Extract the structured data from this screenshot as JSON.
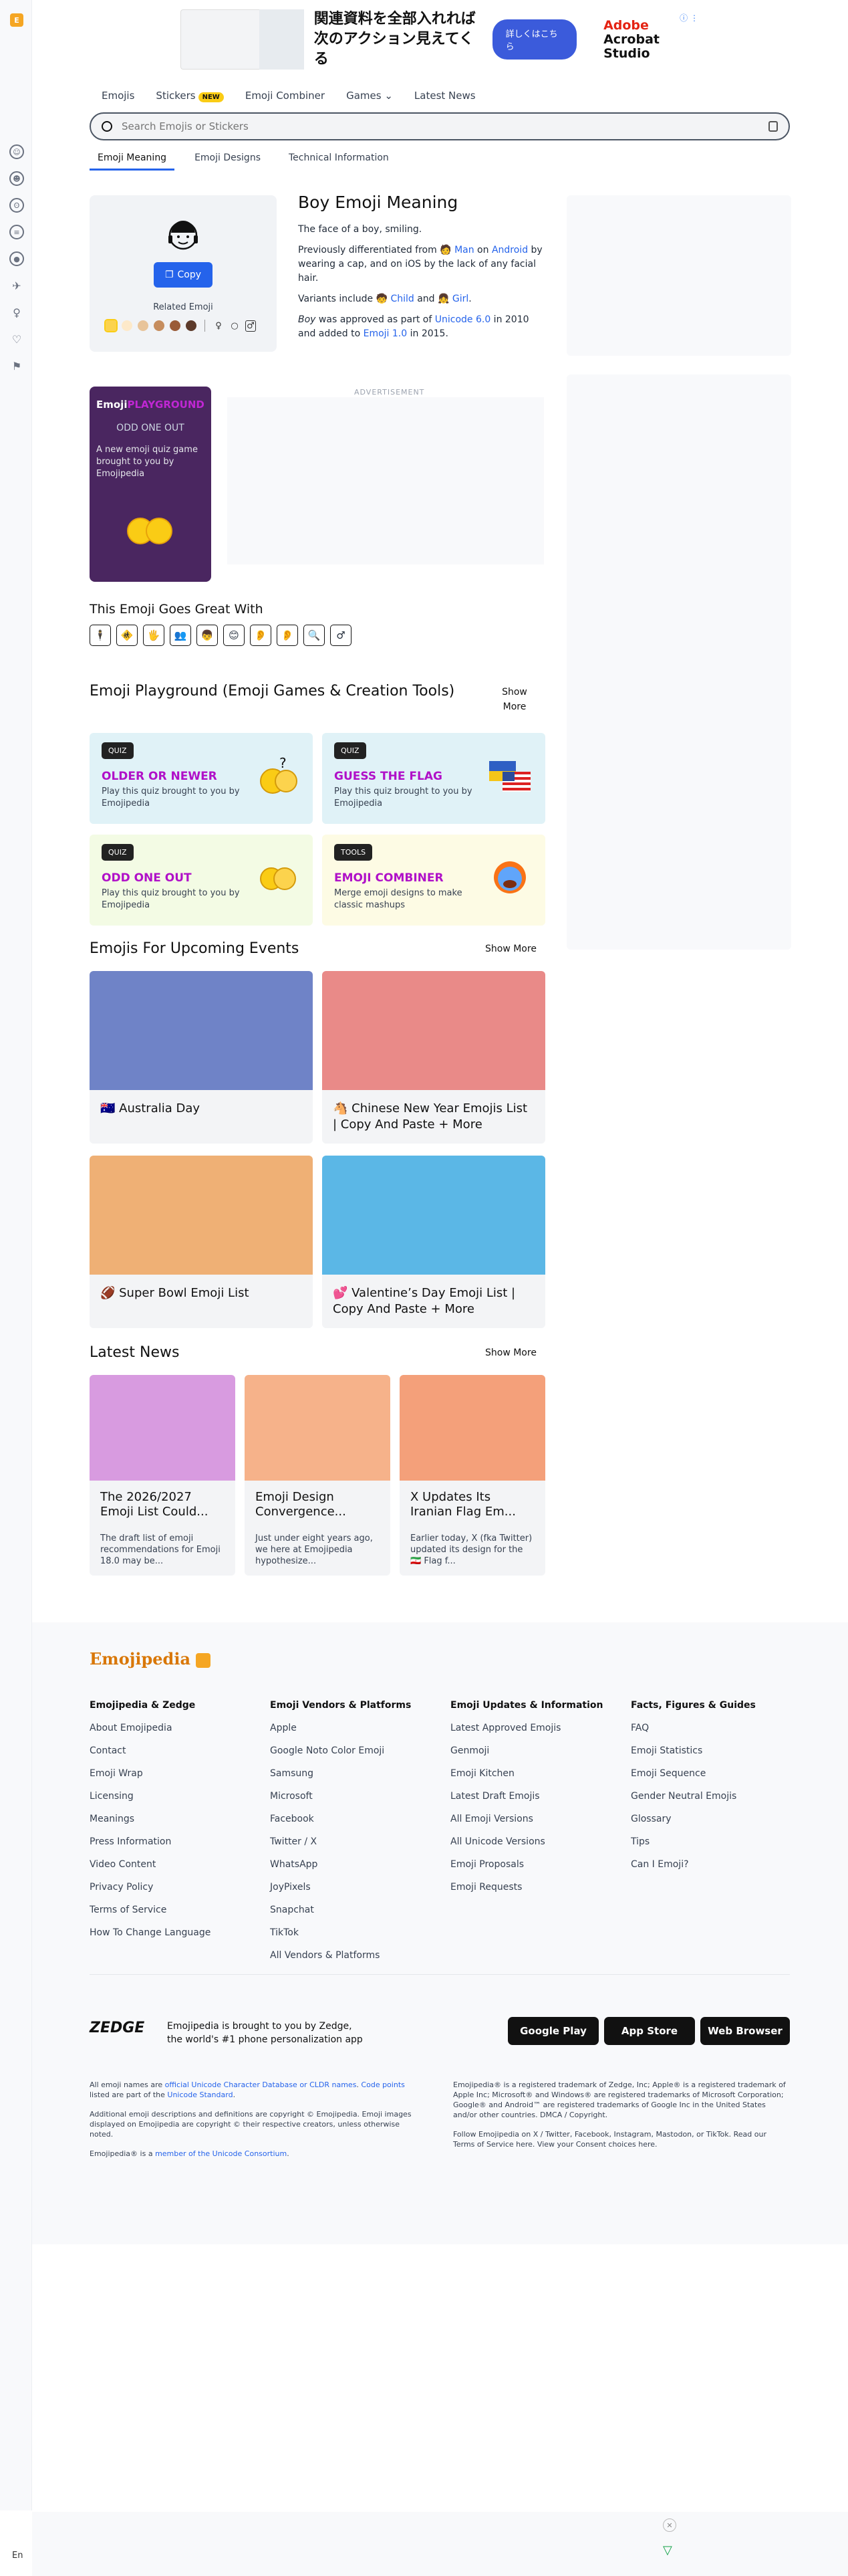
{
  "sidebar": {
    "logo": "E",
    "icons": [
      "smiley-icon",
      "person-icon",
      "bear-icon",
      "burger-icon",
      "ball-icon",
      "rocket-icon",
      "bulb-icon",
      "heart-icon",
      "flag-icon"
    ]
  },
  "ad_top": {
    "headline": "関連資料を全部入れれば\n次のアクション見えてくる",
    "button": "詳しくはこちら",
    "brand_line1": "Adobe",
    "brand_line2": "Acrobat Studio",
    "info": "ⓘ ⋮"
  },
  "nav": {
    "emojis": "Emojis",
    "stickers": "Stickers",
    "new_badge": "NEW",
    "combiner": "Emoji Combiner",
    "games": "Games",
    "games_caret": "⌄",
    "news": "Latest News"
  },
  "search": {
    "placeholder": "Search Emojis or Stickers"
  },
  "tabs": [
    "Emoji Meaning",
    "Emoji Designs",
    "Technical Information"
  ],
  "emoji": {
    "copy": "Copy",
    "related": "Related Emoji",
    "swatch_colors": [
      "#fcd34d",
      "#fde9c9",
      "#e8c49a",
      "#c68d5e",
      "#9a5b38",
      "#5c3a2a"
    ],
    "title": "Boy Emoji Meaning",
    "p1": "The face of a boy, smiling.",
    "p2_pre": "Previously differentiated from ",
    "p2_man": "🧑 Man",
    "p2_on": " on ",
    "p2_android": "Android",
    "p2_post": " by wearing a cap, and on iOS by the lack of any facial hair.",
    "p3_pre": "Variants include ",
    "p3_child": "🧒 Child",
    "p3_and": " and ",
    "p3_girl": "👧 Girl",
    "p3_post": ".",
    "p4_boy": "Boy",
    "p4_a": " was approved as part of ",
    "p4_u6": "Unicode 6.0",
    "p4_b": " in 2010 and added to ",
    "p4_e1": "Emoji 1.0",
    "p4_c": " in 2015."
  },
  "playground_ad": {
    "title_a": "Emoji",
    "title_b": "PLAYGROUND",
    "sub": "ODD ONE OUT",
    "desc": "A new emoji quiz game brought to you by Emojipedia"
  },
  "advertisement": "ADVERTISEMENT",
  "goes_great": {
    "title": "This Emoji Goes Great With",
    "items": [
      "🕴",
      "🚸",
      "🖐",
      "👥",
      "👦",
      "😊",
      "👂",
      "👂",
      "🔍",
      "♂"
    ]
  },
  "playground": {
    "title": "Emoji Playground (Emoji Games & Creation Tools)",
    "show_more": "Show More",
    "cards": [
      {
        "tag": "QUIZ",
        "name": "OLDER OR NEWER",
        "desc": "Play this quiz brought to you by Emojipedia",
        "bg": "#e0f2f7"
      },
      {
        "tag": "QUIZ",
        "name": "GUESS THE FLAG",
        "desc": "Play this quiz brought to you by Emojipedia",
        "bg": "#e0f2f7"
      },
      {
        "tag": "QUIZ",
        "name": "ODD ONE OUT",
        "desc": "Play this quiz brought to you by Emojipedia",
        "bg": "#f3fbe4"
      },
      {
        "tag": "TOOLS",
        "name": "EMOJI COMBINER",
        "desc": "Merge emoji designs to make classic mashups",
        "bg": "#fdfbe4"
      }
    ]
  },
  "events": {
    "title": "Emojis For Upcoming Events",
    "show_more": "Show More",
    "cards": [
      {
        "title": "🇦🇺 Australia Day",
        "bg": "#6f83c7"
      },
      {
        "title": "🐴 Chinese New Year Emojis List | Copy And Paste + More",
        "bg": "#e98a88"
      },
      {
        "title": "🏈 Super Bowl Emoji List",
        "bg": "#efb075"
      },
      {
        "title": "💕 Valentine’s Day Emoji List | Copy And Paste + More",
        "bg": "#5bb7e6"
      }
    ]
  },
  "news": {
    "title": "Latest News",
    "show_more": "Show More",
    "cards": [
      {
        "title": "The 2026/2027 Emoji List Could...",
        "desc": "The draft list of emoji recommendations for Emoji 18.0 may be...",
        "bg": "#d89be0"
      },
      {
        "title": "Emoji Design Convergence...",
        "desc": "Just under eight years ago, we here at Emojipedia hypothesize...",
        "bg": "#f6b28a"
      },
      {
        "title": "X Updates Its Iranian Flag Em...",
        "desc": "Earlier today, X (fka Twitter) updated its design for the 🇮🇷 Flag f...",
        "bg": "#f4a07a"
      }
    ]
  },
  "footer": {
    "logo": "Emojipedia",
    "cols": [
      {
        "title": "Emojipedia & Zedge",
        "links": [
          "About Emojipedia",
          "Contact",
          "Emoji Wrap",
          "Licensing",
          "Meanings",
          "Press Information",
          "Video Content",
          "Privacy Policy",
          "Terms of Service",
          "How To Change Language"
        ]
      },
      {
        "title": "Emoji Vendors & Platforms",
        "links": [
          "Apple",
          "Google Noto Color Emoji",
          "Samsung",
          "Microsoft",
          "Facebook",
          "Twitter / X",
          "WhatsApp",
          "JoyPixels",
          "Snapchat",
          "TikTok",
          "All Vendors & Platforms"
        ]
      },
      {
        "title": "Emoji Updates & Information",
        "links": [
          "Latest Approved Emojis",
          "Genmoji",
          "Emoji Kitchen",
          "Latest Draft Emojis",
          "All Emoji Versions",
          "All Unicode Versions",
          "Emoji Proposals",
          "Emoji Requests"
        ]
      },
      {
        "title": "Facts, Figures & Guides",
        "links": [
          "FAQ",
          "Emoji Statistics",
          "Emoji Sequence",
          "Gender Neutral Emojis",
          "Glossary",
          "Tips",
          "Can I Emoji?"
        ]
      }
    ],
    "zedge": "ZEDGE",
    "zedge_text": "Emojipedia is brought to you by Zedge,\nthe world's #1 phone personalization app",
    "stores": [
      "Google Play",
      "App Store",
      "Web Browser"
    ],
    "legal_left_1a": "All emoji names are ",
    "legal_left_1b": "official Unicode Character Database or CLDR names",
    "legal_left_1c": ". ",
    "legal_left_1d": "Code points",
    "legal_left_1e": " listed are part of the ",
    "legal_left_1f": "Unicode Standard",
    "legal_left_1g": ".",
    "legal_left_2": "Additional emoji descriptions and definitions are copyright © Emojipedia. Emoji images displayed on Emojipedia are copyright © their respective creators, unless otherwise noted.",
    "legal_left_3a": "Emojipedia® is a ",
    "legal_left_3b": "member of the Unicode Consortium",
    "legal_left_3c": ".",
    "legal_right_1": "Emojipedia® is a registered trademark of Zedge, Inc; Apple® is a registered trademark of Apple Inc; Microsoft® and Windows® are registered trademarks of Microsoft Corporation; Google® and Android™ are registered trademarks of Google Inc in the United States and/or other countries. DMCA / Copyright.",
    "legal_right_2": "Follow Emojipedia on X / Twitter, Facebook, Instagram, Mastodon, or TikTok. Read our Terms of Service here. View your Consent choices here."
  },
  "bottom": {
    "lang": "En"
  }
}
